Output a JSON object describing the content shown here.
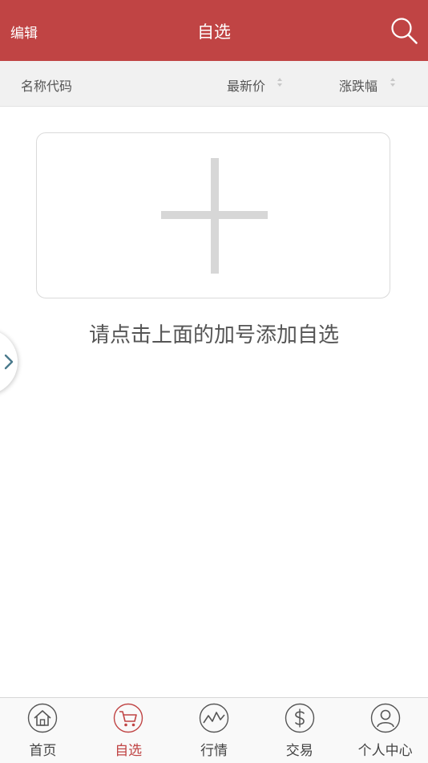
{
  "header": {
    "edit_label": "编辑",
    "title": "自选",
    "search_icon": "search-icon"
  },
  "columns": {
    "name": "名称代码",
    "price": "最新价",
    "change": "涨跌幅"
  },
  "empty_state": {
    "add_icon": "plus-icon",
    "hint": "请点击上面的加号添加自选"
  },
  "side_drawer": {
    "icon": "chevron-right-icon"
  },
  "tabbar": {
    "active_index": 1,
    "items": [
      {
        "label": "首页",
        "icon": "home-icon"
      },
      {
        "label": "自选",
        "icon": "cart-icon"
      },
      {
        "label": "行情",
        "icon": "trend-icon"
      },
      {
        "label": "交易",
        "icon": "dollar-icon"
      },
      {
        "label": "个人中心",
        "icon": "user-icon"
      }
    ]
  },
  "colors": {
    "brand": "#c04444",
    "active_tab": "#c04444",
    "icon_gray": "#555555"
  }
}
